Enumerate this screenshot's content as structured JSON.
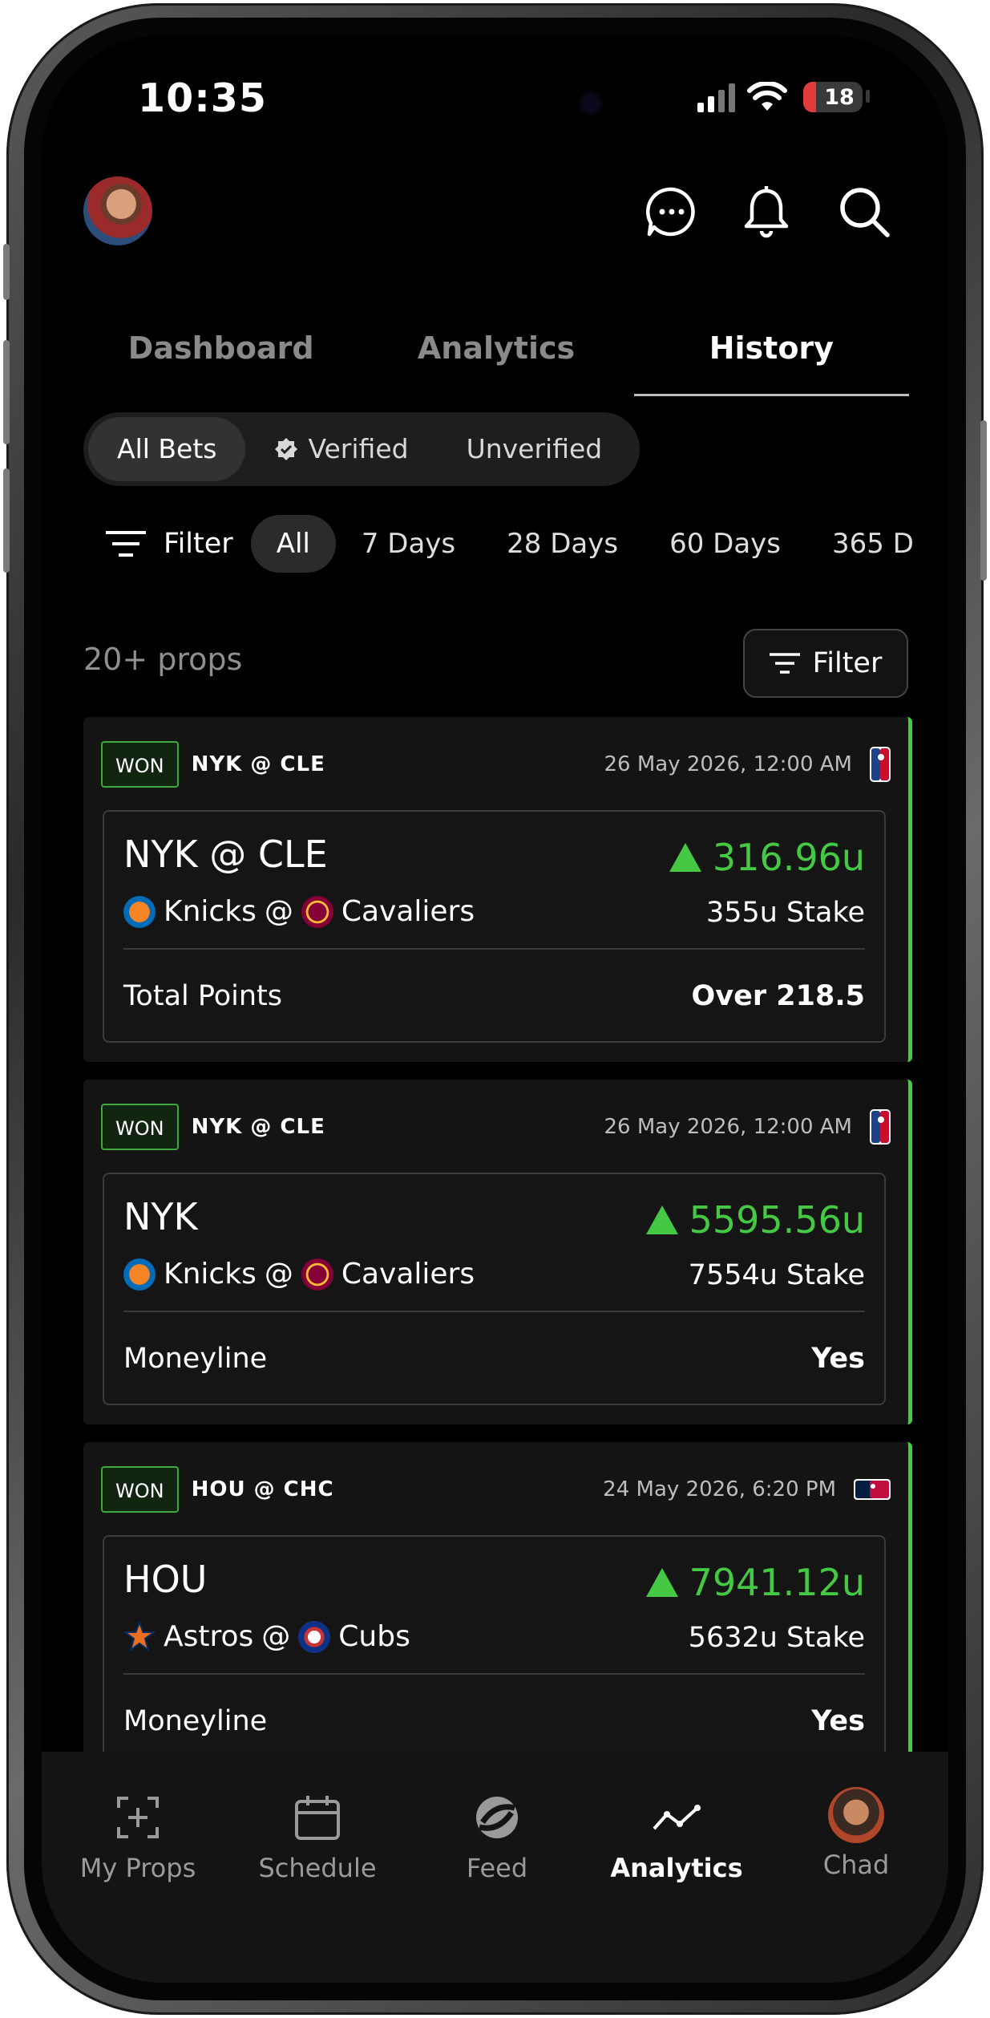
{
  "status_bar": {
    "time": "10:35",
    "battery": "18"
  },
  "tabs": [
    {
      "label": "Dashboard",
      "active": false
    },
    {
      "label": "Analytics",
      "active": false
    },
    {
      "label": "History",
      "active": true
    }
  ],
  "bet_filter": {
    "all": "All Bets",
    "verified": "Verified",
    "unverified": "Unverified",
    "selected": "All Bets"
  },
  "time_filter": {
    "label": "Filter",
    "options": [
      "All",
      "7 Days",
      "28 Days",
      "60 Days",
      "365 D"
    ],
    "selected": "All"
  },
  "list_header": {
    "count": "20+ props",
    "filter_button": "Filter"
  },
  "bets": [
    {
      "status": "WON",
      "game": "NYK @ CLE",
      "date": "26 May 2026, 12:00 AM",
      "league_icon": "nba-logo",
      "pick": "NYK @ CLE",
      "amount": "316.96u",
      "away_team": "Knicks",
      "home_team": "Cavaliers",
      "separator": "@",
      "stake": "355u Stake",
      "market": "Total Points",
      "selection": "Over 218.5"
    },
    {
      "status": "WON",
      "game": "NYK @ CLE",
      "date": "26 May 2026, 12:00 AM",
      "league_icon": "nba-logo",
      "pick": "NYK",
      "amount": "5595.56u",
      "away_team": "Knicks",
      "home_team": "Cavaliers",
      "separator": "@",
      "stake": "7554u Stake",
      "market": "Moneyline",
      "selection": "Yes"
    },
    {
      "status": "WON",
      "game": "HOU @ CHC",
      "date": "24 May 2026, 6:20 PM",
      "league_icon": "mlb-logo",
      "pick": "HOU",
      "amount": "7941.12u",
      "away_team": "Astros",
      "home_team": "Cubs",
      "separator": "@",
      "stake": "5632u Stake",
      "market": "Moneyline",
      "selection": "Yes"
    }
  ],
  "bottom_nav": [
    {
      "label": "My Props",
      "icon": "add-square-icon"
    },
    {
      "label": "Schedule",
      "icon": "calendar-icon"
    },
    {
      "label": "Feed",
      "icon": "feed-logo-icon"
    },
    {
      "label": "Analytics",
      "icon": "trend-line-icon",
      "active": true
    },
    {
      "label": "Chad",
      "icon": "avatar"
    }
  ],
  "colors": {
    "accent_green": "#45c945",
    "background": "#000000",
    "card": "#141414"
  }
}
